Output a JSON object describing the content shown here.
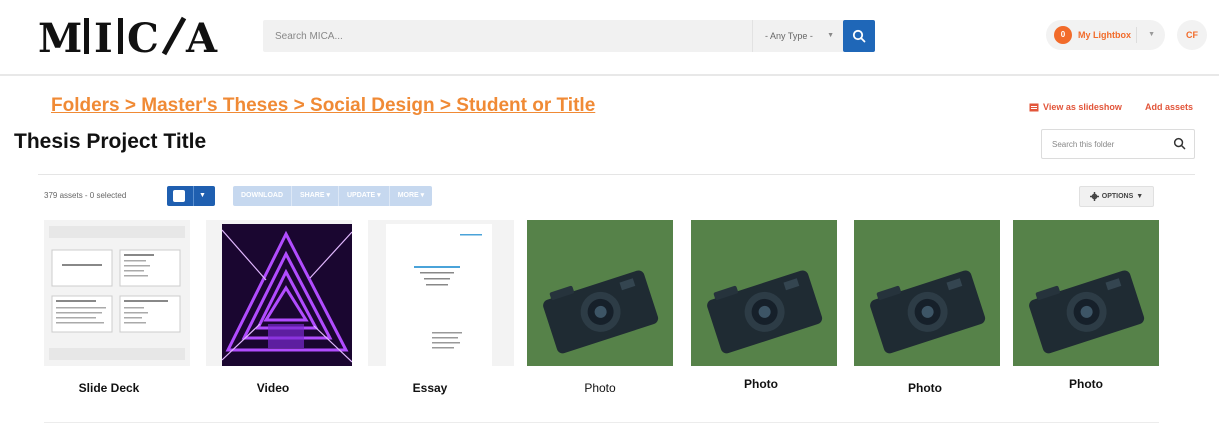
{
  "header": {
    "logo_text": "M|C/A",
    "logo_letters": [
      "M",
      "I",
      "C",
      "A"
    ],
    "search_placeholder": "Search MICA...",
    "type_select_value": "- Any Type -",
    "lightbox_count": "0",
    "lightbox_label": "My Lightbox",
    "avatar_initials": "CF"
  },
  "breadcrumb": "Folders > Master's Theses > Social Design > Student or Title",
  "page_title": "Thesis Project Title",
  "actions": {
    "view_slideshow": "View as slideshow",
    "add_assets": "Add assets",
    "folder_search_placeholder": "Search this folder"
  },
  "toolbar": {
    "assets_count": "379 assets - 0 selected",
    "bulk_actions": [
      "DOWNLOAD",
      "SHARE ▾",
      "UPDATE ▾",
      "MORE ▾"
    ],
    "options_label": "OPTIONS"
  },
  "assets": [
    {
      "label": "Slide Deck",
      "type": "slides",
      "bold": true
    },
    {
      "label": "Video",
      "type": "video",
      "bold": true
    },
    {
      "label": "Essay",
      "type": "document",
      "bold": true
    },
    {
      "label": "Photo",
      "type": "photo",
      "bold": false
    },
    {
      "label": "Photo",
      "type": "photo",
      "bold": true
    },
    {
      "label": "Photo",
      "type": "photo",
      "bold": true
    },
    {
      "label": "Photo",
      "type": "photo",
      "bold": true
    }
  ],
  "colors": {
    "accent_orange": "#f08a35",
    "primary_blue": "#1f67b8",
    "link_red": "#e2553a"
  }
}
